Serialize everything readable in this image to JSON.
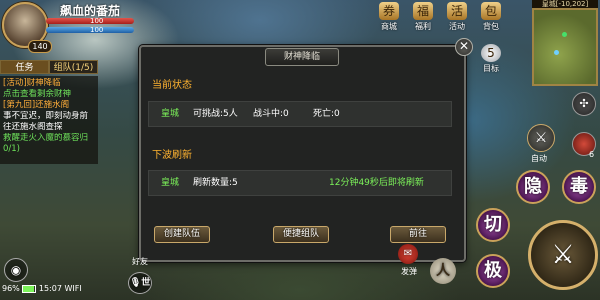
{
  "player": {
    "name": "飙血的番茄",
    "level": "140",
    "hp": "100",
    "mp": "100"
  },
  "quest_panel": {
    "tabs": [
      "任务",
      "组队(1/5)"
    ],
    "lines": [
      {
        "text": "[活动]财神降临",
        "style": "qhead"
      },
      {
        "text": "点击查看剩余财神",
        "style": "qbody"
      },
      {
        "text": "[第九回]还施水阁",
        "style": "qhead"
      },
      {
        "text": "事不宜迟，即刻动身前",
        "style": "qwhite"
      },
      {
        "text": "往还施水阁查探",
        "style": "qwhite"
      },
      {
        "text": "救醒走火入魔的慕容归",
        "style": "qbody"
      },
      {
        "text": "0/1)",
        "style": "qbody"
      }
    ]
  },
  "top_icons": [
    {
      "label": "商城",
      "glyph": "券"
    },
    {
      "label": "福利",
      "glyph": "福"
    },
    {
      "label": "活动",
      "glyph": "活"
    },
    {
      "label": "背包",
      "glyph": "包"
    }
  ],
  "target_label": "目标",
  "target_count": "5",
  "minimap": {
    "location": "皇城[-10,202]"
  },
  "dialog": {
    "title": "财神降临",
    "close_glyph": "✕",
    "current_status_label": "当前状态",
    "status_row": {
      "city": "皇城",
      "challengeable": "可挑战:5人",
      "in_battle": "战斗中:0",
      "dead": "死亡:0"
    },
    "next_wave_label": "下波刷新",
    "refresh_row": {
      "city": "皇城",
      "refresh_count": "刷新数量:5",
      "countdown": "12分钟49秒后即将刷新"
    },
    "buttons": [
      "创建队伍",
      "便捷组队",
      "前往"
    ]
  },
  "skills": {
    "auto": "自动",
    "hide": "隐",
    "poison": "毒",
    "cut": "切",
    "extreme": "极",
    "potion_count": "6"
  },
  "bottom": {
    "battery": "96%",
    "time": "15:07",
    "network": "WIFI",
    "left_btn": "好友",
    "world_btn": "世",
    "red_btn": "发弹",
    "ride_label": "人"
  }
}
